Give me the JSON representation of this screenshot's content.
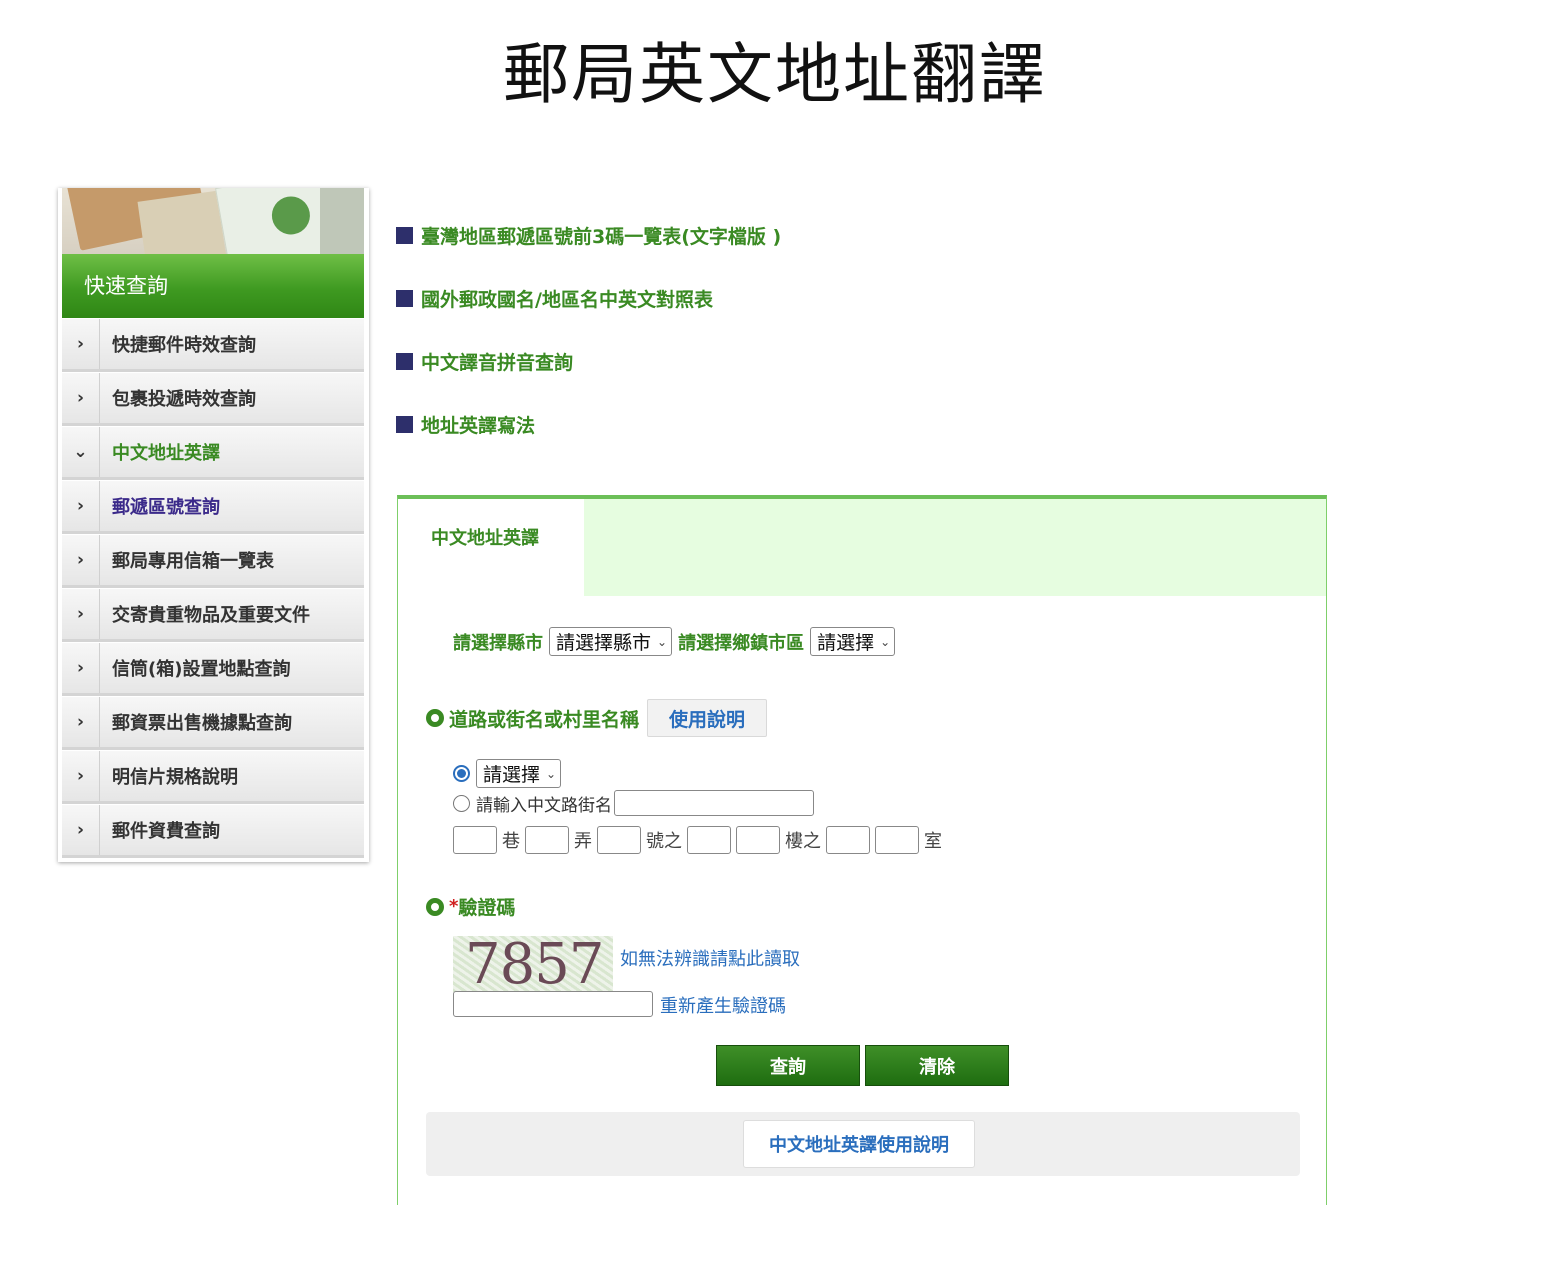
{
  "page": {
    "title": "郵局英文地址翻譯"
  },
  "sidebar": {
    "header": "快速查詢",
    "items": [
      {
        "label": "快捷郵件時效查詢",
        "arrow": "›"
      },
      {
        "label": "包裹投遞時效查詢",
        "arrow": "›"
      },
      {
        "label": "中文地址英譯",
        "arrow": "⌄"
      },
      {
        "label": "郵遞區號查詢",
        "arrow": "›"
      },
      {
        "label": "郵局專用信箱一覽表",
        "arrow": "›"
      },
      {
        "label": "交寄貴重物品及重要文件",
        "arrow": "›"
      },
      {
        "label": "信筒(箱)設置地點查詢",
        "arrow": "›"
      },
      {
        "label": "郵資票出售機據點查詢",
        "arrow": "›"
      },
      {
        "label": "明信片規格說明",
        "arrow": "›"
      },
      {
        "label": "郵件資費查詢",
        "arrow": "›"
      }
    ]
  },
  "links": [
    "臺灣地區郵遞區號前3碼一覽表(文字檔版 )",
    "國外郵政國名/地區名中英文對照表",
    "中文譯音拼音查詢",
    "地址英譯寫法"
  ],
  "panel": {
    "tab_label": "中文地址英譯",
    "county_label": "請選擇縣市",
    "county_select": "請選擇縣市",
    "township_label": "請選擇鄉鎮市區",
    "township_select": "請選擇",
    "road_heading": "道路或街名或村里名稱",
    "help_button": "使用說明",
    "road_select": "請選擇",
    "road_input_label": "請輸入中文路街名",
    "addr_units": {
      "lane": "巷",
      "alley": "弄",
      "number": "號之",
      "floor": "樓之",
      "room": "室"
    },
    "captcha_heading_star": "*",
    "captcha_heading": "驗證碼",
    "captcha_text": "7857",
    "captcha_audio_link": "如無法辨識請點此讀取",
    "captcha_regen_link": "重新產生驗證碼",
    "query_button": "查詢",
    "clear_button": "清除",
    "manual_button": "中文地址英譯使用說明"
  },
  "colors": {
    "green": "#3a8a23",
    "link_blue": "#2a6ebd",
    "tab_bg": "#e6fde0",
    "square": "#2d2f6b"
  }
}
